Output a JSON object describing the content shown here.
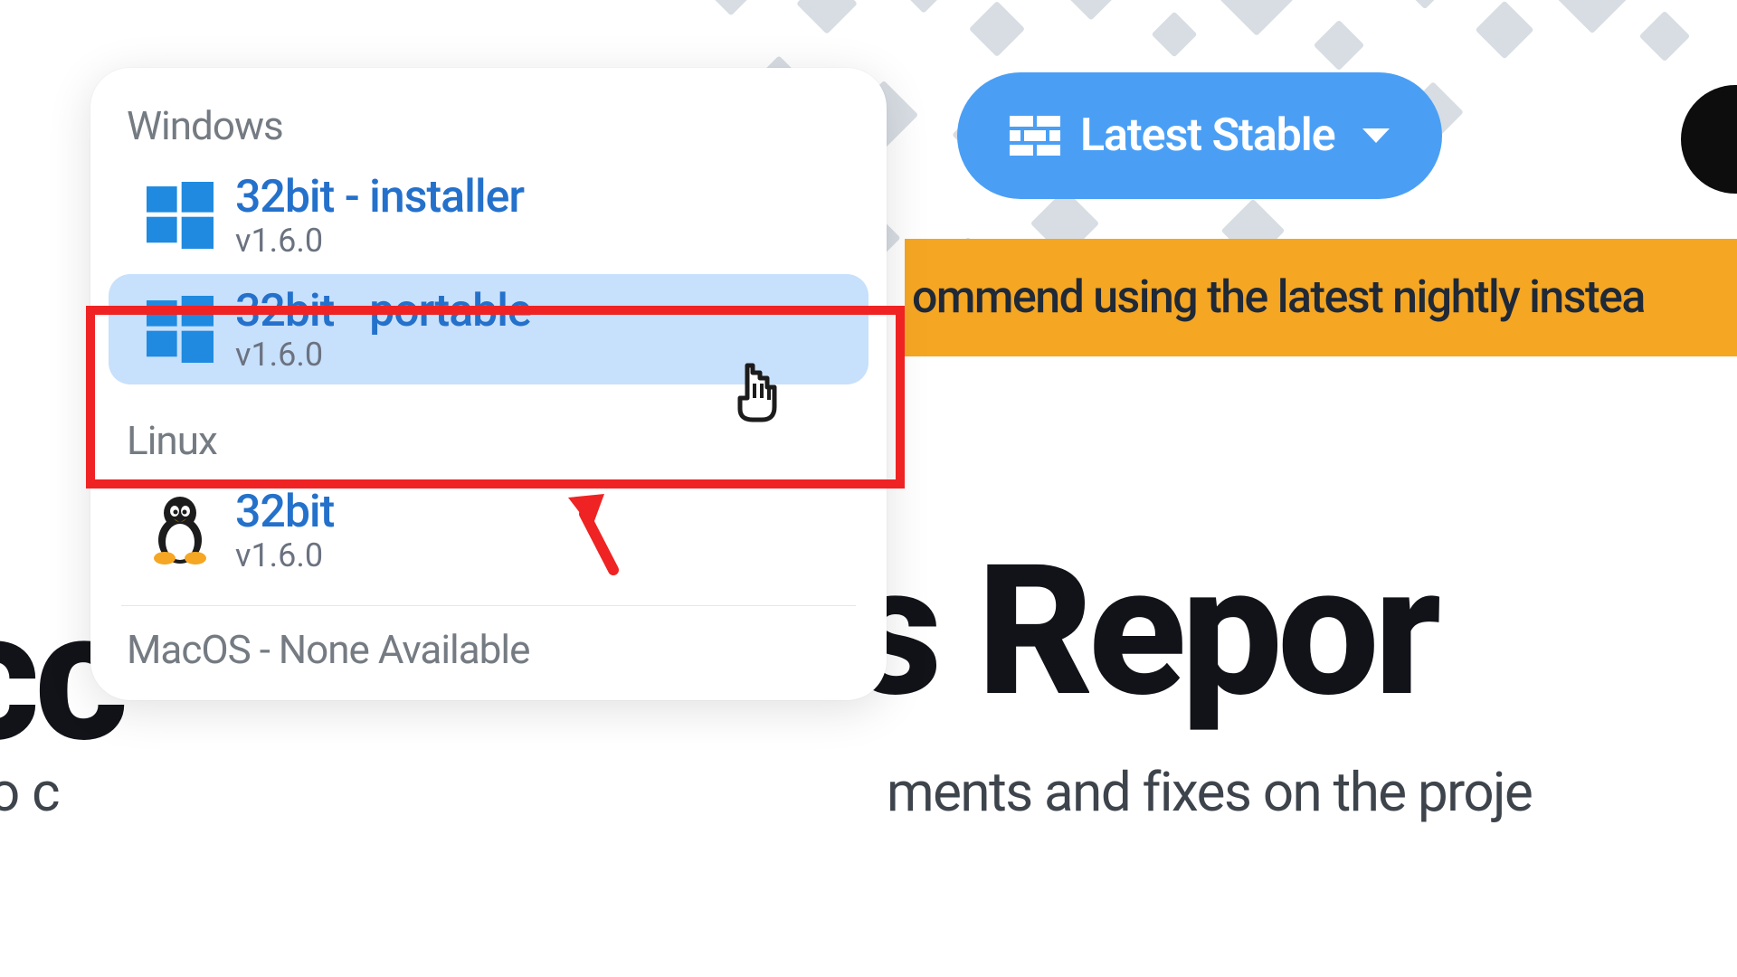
{
  "dropdown": {
    "groups": [
      {
        "label": "Windows",
        "items": [
          {
            "title": "32bit - installer",
            "version": "v1.6.0",
            "os": "windows",
            "highlighted": false
          },
          {
            "title": "32bit - portable",
            "version": "v1.6.0",
            "os": "windows",
            "highlighted": true
          }
        ]
      },
      {
        "label": "Linux",
        "items": [
          {
            "title": "32bit",
            "version": "v1.6.0",
            "os": "linux",
            "highlighted": false
          }
        ]
      }
    ],
    "macos_none": "MacOS - None Available"
  },
  "stable_button": {
    "label": "Latest Stable"
  },
  "banner": {
    "text": "ommend using the latest nightly instea"
  },
  "headline_right": "ess Repor",
  "headline_left": "cc",
  "subtext_left": "to c",
  "subtext_right": "ments and fixes on the proje",
  "colors": {
    "accent_blue": "#4a9ff5",
    "link_blue": "#2471cb",
    "orange": "#f5a623",
    "annotation_red": "#ef2323"
  }
}
